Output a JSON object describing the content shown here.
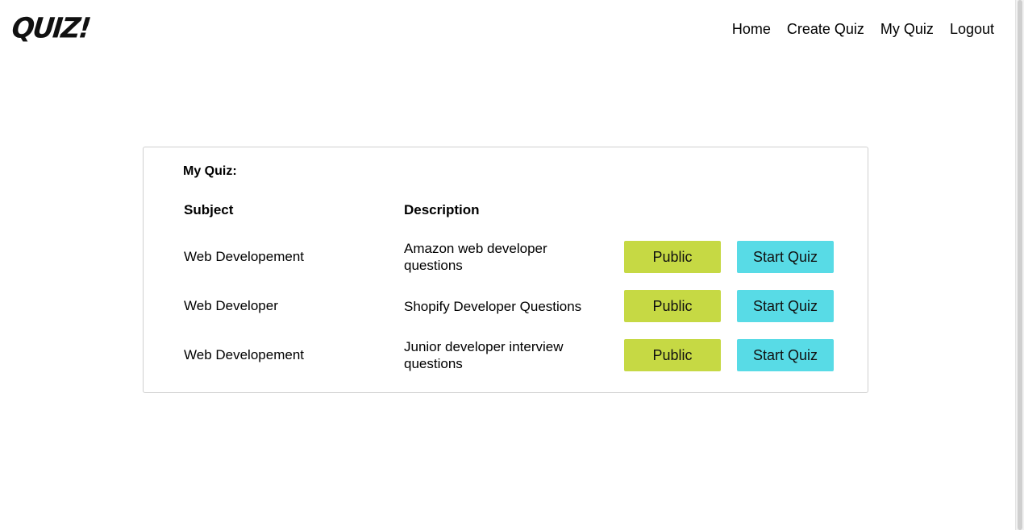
{
  "header": {
    "logo": "QUIZ!",
    "nav": [
      "Home",
      "Create Quiz",
      "My Quiz",
      "Logout"
    ]
  },
  "quiz_panel": {
    "title": "My Quiz:",
    "columns": {
      "subject": "Subject",
      "description": "Description"
    },
    "rows": [
      {
        "subject": "Web Developement",
        "description": "Amazon web developer questions",
        "visibility_label": "Public",
        "start_label": "Start Quiz"
      },
      {
        "subject": "Web Developer",
        "description": "Shopify Developer Questions",
        "visibility_label": "Public",
        "start_label": "Start Quiz"
      },
      {
        "subject": "Web Developement",
        "description": "Junior developer interview questions",
        "visibility_label": "Public",
        "start_label": "Start Quiz"
      }
    ]
  },
  "colors": {
    "public_button": "#c6d944",
    "start_button": "#58dbe6",
    "card_border": "#cfcfcf"
  }
}
